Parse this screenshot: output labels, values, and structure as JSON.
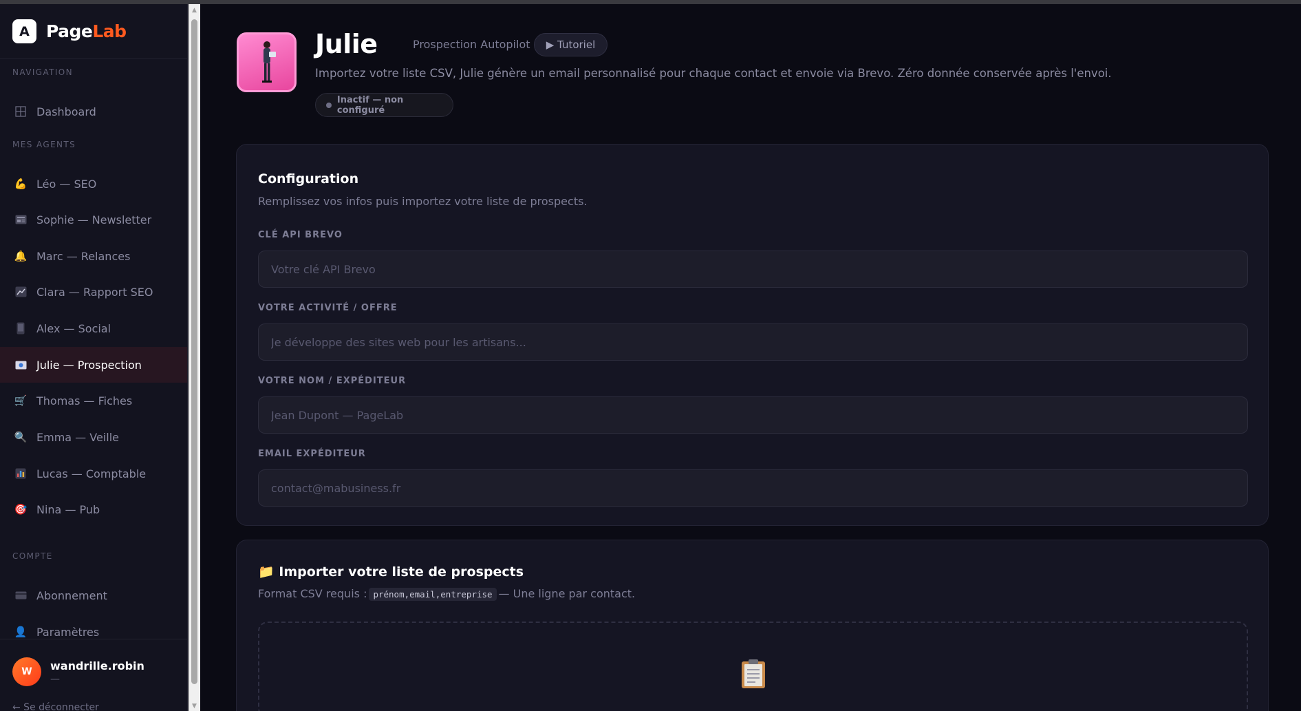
{
  "brand": {
    "logo_letter": "A",
    "name_part1": "Page",
    "name_part2": "Lab",
    "accent": "#ff5a1f"
  },
  "sidebar": {
    "sections": {
      "navigation": "NAVIGATION",
      "agents": "MES AGENTS",
      "account": "COMPTE"
    },
    "nav_items": [
      {
        "label": "Dashboard",
        "icon": "grid-icon"
      }
    ],
    "agent_items": [
      {
        "label": "Léo — SEO",
        "icon": "muscle-icon"
      },
      {
        "label": "Sophie — Newsletter",
        "icon": "newspaper-icon"
      },
      {
        "label": "Marc — Relances",
        "icon": "bell-icon"
      },
      {
        "label": "Clara — Rapport SEO",
        "icon": "chart-icon"
      },
      {
        "label": "Alex — Social",
        "icon": "phone-icon"
      },
      {
        "label": "Julie — Prospection",
        "icon": "id-card-icon",
        "active": true
      },
      {
        "label": "Thomas — Fiches",
        "icon": "cart-icon"
      },
      {
        "label": "Emma — Veille",
        "icon": "magnifier-icon"
      },
      {
        "label": "Lucas — Comptable",
        "icon": "bar-chart-icon"
      },
      {
        "label": "Nina — Pub",
        "icon": "target-icon"
      }
    ],
    "account_items": [
      {
        "label": "Abonnement",
        "icon": "credit-card-icon"
      },
      {
        "label": "Paramètres",
        "icon": "user-icon"
      }
    ],
    "user": {
      "initial": "W",
      "name": "wandrille.robin",
      "sub": "—"
    },
    "logout": "← Se déconnecter"
  },
  "agent": {
    "name": "Julie",
    "role": "Prospection Autopilot",
    "tutorial_label": "▶ Tutoriel",
    "description": "Importez votre liste CSV, Julie génère un email personnalisé pour chaque contact et envoie via Brevo. Zéro donnée conservée après l'envoi.",
    "status": "Inactif — non configuré"
  },
  "config": {
    "title": "Configuration",
    "subtitle": "Remplissez vos infos puis importez votre liste de prospects.",
    "fields": [
      {
        "label": "CLÉ API BREVO",
        "value": "",
        "placeholder": "Votre clé API Brevo"
      },
      {
        "label": "VOTRE ACTIVITÉ / OFFRE",
        "value": "",
        "placeholder": "Je développe des sites web pour les artisans..."
      },
      {
        "label": "VOTRE NOM / EXPÉDITEUR",
        "value": "",
        "placeholder": "Jean Dupont — PageLab"
      },
      {
        "label": "EMAIL EXPÉDITEUR",
        "value": "",
        "placeholder": "contact@mabusiness.fr"
      }
    ]
  },
  "import": {
    "icon": "📁",
    "title": "Importer votre liste de prospects",
    "format_prefix": "Format CSV requis :",
    "format_code": "prénom,email,entreprise",
    "format_suffix": "— Une ligne par contact."
  }
}
